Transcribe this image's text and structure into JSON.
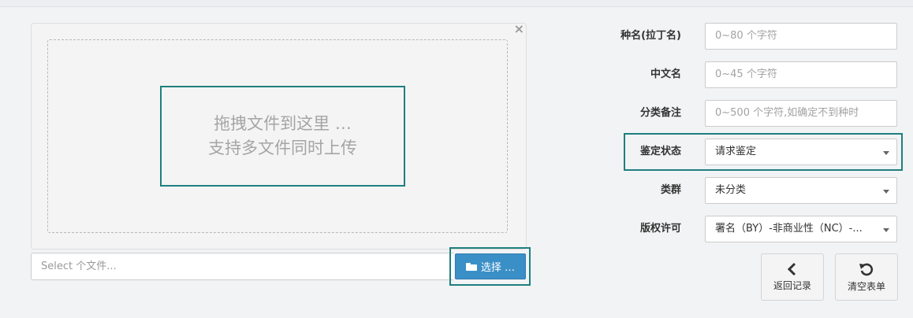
{
  "upload": {
    "close_label": "×",
    "hint_line1": "拖拽文件到这里 …",
    "hint_line2": "支持多文件同时上传",
    "file_placeholder": "Select 个文件...",
    "browse_label": "选择 …"
  },
  "form": {
    "latin_name": {
      "label": "种名(拉丁名)",
      "placeholder": "0~80 个字符"
    },
    "chinese_name": {
      "label": "中文名",
      "placeholder": "0~45 个字符"
    },
    "taxonomy_note": {
      "label": "分类备注",
      "placeholder": "0~500 个字符,如确定不到种时"
    },
    "identification_status": {
      "label": "鉴定状态",
      "value": "请求鉴定"
    },
    "group": {
      "label": "类群",
      "value": "未分类"
    },
    "license": {
      "label": "版权许可",
      "value": "署名（BY）-非商业性（NC）-..."
    }
  },
  "actions": {
    "back_label": "返回记录",
    "clear_label": "清空表单"
  },
  "colors": {
    "highlight": "#1f7f7f",
    "primary": "#3a8fc7"
  }
}
